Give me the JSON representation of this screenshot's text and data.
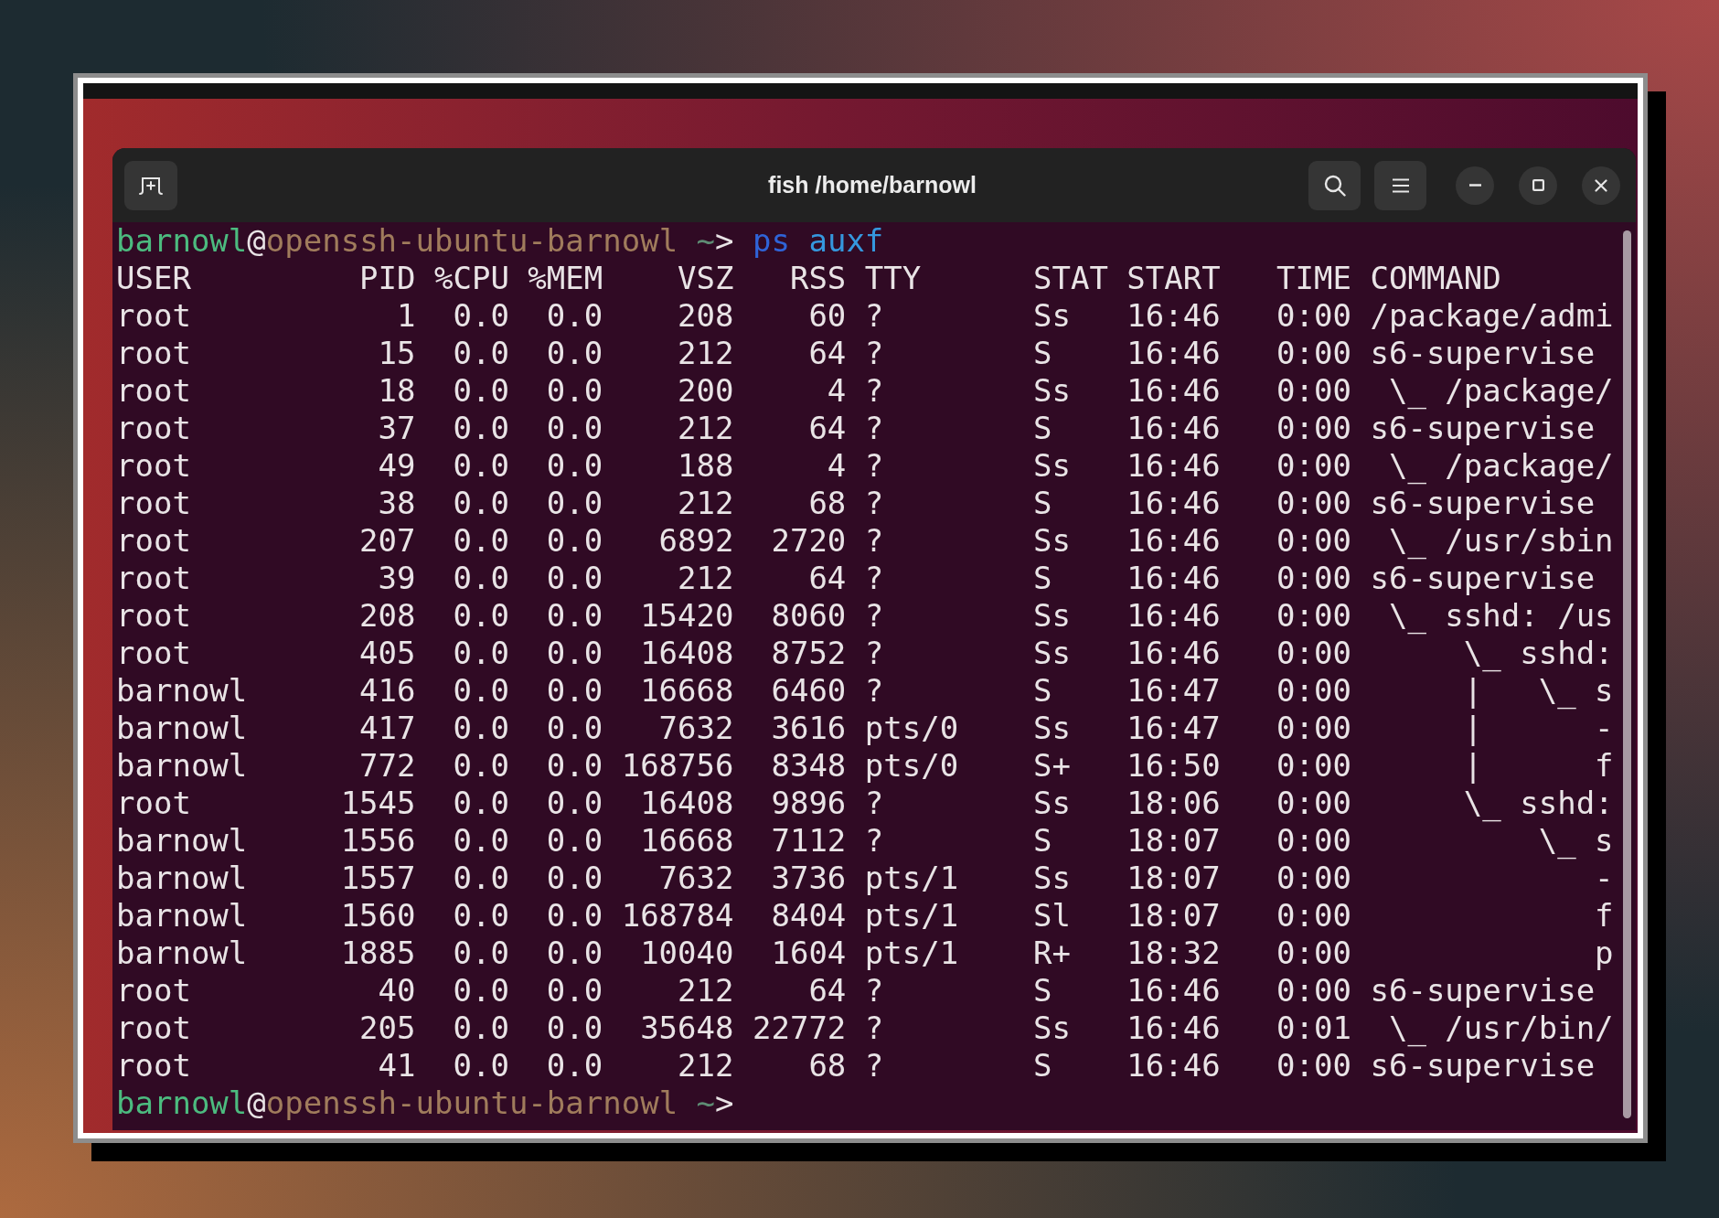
{
  "window": {
    "title": "fish /home/barnowl"
  },
  "terminal": {
    "lines": [
      {
        "kind": "prompt",
        "prompt": [
          {
            "kind": "user",
            "text": "barnowl"
          },
          {
            "kind": "symbol",
            "text": "@"
          },
          {
            "kind": "host",
            "text": "openssh-ubuntu-barnowl"
          },
          {
            "kind": "cwd",
            "text": " ~"
          },
          {
            "kind": "symbol",
            "text": ">"
          }
        ],
        "command": [
          {
            "kind": "command",
            "text": "ps"
          },
          {
            "kind": "argument",
            "text": " auxf"
          }
        ]
      },
      {
        "kind": "output",
        "text": "USER         PID %CPU %MEM    VSZ   RSS TTY      STAT START   TIME COMMAND"
      },
      {
        "kind": "output",
        "text": "root           1  0.0  0.0    208    60 ?        Ss   16:46   0:00 /package/admi"
      },
      {
        "kind": "output",
        "text": "root          15  0.0  0.0    212    64 ?        S    16:46   0:00 s6-supervise"
      },
      {
        "kind": "output",
        "text": "root          18  0.0  0.0    200     4 ?        Ss   16:46   0:00  \\_ /package/"
      },
      {
        "kind": "output",
        "text": "root          37  0.0  0.0    212    64 ?        S    16:46   0:00 s6-supervise"
      },
      {
        "kind": "output",
        "text": "root          49  0.0  0.0    188     4 ?        Ss   16:46   0:00  \\_ /package/"
      },
      {
        "kind": "output",
        "text": "root          38  0.0  0.0    212    68 ?        S    16:46   0:00 s6-supervise"
      },
      {
        "kind": "output",
        "text": "root         207  0.0  0.0   6892  2720 ?        Ss   16:46   0:00  \\_ /usr/sbin"
      },
      {
        "kind": "output",
        "text": "root          39  0.0  0.0    212    64 ?        S    16:46   0:00 s6-supervise"
      },
      {
        "kind": "output",
        "text": "root         208  0.0  0.0  15420  8060 ?        Ss   16:46   0:00  \\_ sshd: /us"
      },
      {
        "kind": "output",
        "text": "root         405  0.0  0.0  16408  8752 ?        Ss   16:46   0:00      \\_ sshd:"
      },
      {
        "kind": "output",
        "text": "barnowl      416  0.0  0.0  16668  6460 ?        S    16:47   0:00      |   \\_ s"
      },
      {
        "kind": "output",
        "text": "barnowl      417  0.0  0.0   7632  3616 pts/0    Ss   16:47   0:00      |      -"
      },
      {
        "kind": "output",
        "text": "barnowl      772  0.0  0.0 168756  8348 pts/0    S+   16:50   0:00      |      f"
      },
      {
        "kind": "output",
        "text": "root        1545  0.0  0.0  16408  9896 ?        Ss   18:06   0:00      \\_ sshd:"
      },
      {
        "kind": "output",
        "text": "barnowl     1556  0.0  0.0  16668  7112 ?        S    18:07   0:00          \\_ s"
      },
      {
        "kind": "output",
        "text": "barnowl     1557  0.0  0.0   7632  3736 pts/1    Ss   18:07   0:00             -"
      },
      {
        "kind": "output",
        "text": "barnowl     1560  0.0  0.0 168784  8404 pts/1    Sl   18:07   0:00             f"
      },
      {
        "kind": "output",
        "text": "barnowl     1885  0.0  0.0  10040  1604 pts/1    R+   18:32   0:00             p"
      },
      {
        "kind": "output",
        "text": "root          40  0.0  0.0    212    64 ?        S    16:46   0:00 s6-supervise"
      },
      {
        "kind": "output",
        "text": "root         205  0.0  0.0  35648 22772 ?        Ss   16:46   0:01  \\_ /usr/bin/"
      },
      {
        "kind": "output",
        "text": "root          41  0.0  0.0    212    68 ?        S    16:46   0:00 s6-supervise"
      },
      {
        "kind": "prompt",
        "prompt": [
          {
            "kind": "user",
            "text": "barnowl"
          },
          {
            "kind": "symbol",
            "text": "@"
          },
          {
            "kind": "host",
            "text": "openssh-ubuntu-barnowl"
          },
          {
            "kind": "cwd",
            "text": " ~"
          },
          {
            "kind": "symbol",
            "text": ">"
          }
        ]
      }
    ]
  }
}
